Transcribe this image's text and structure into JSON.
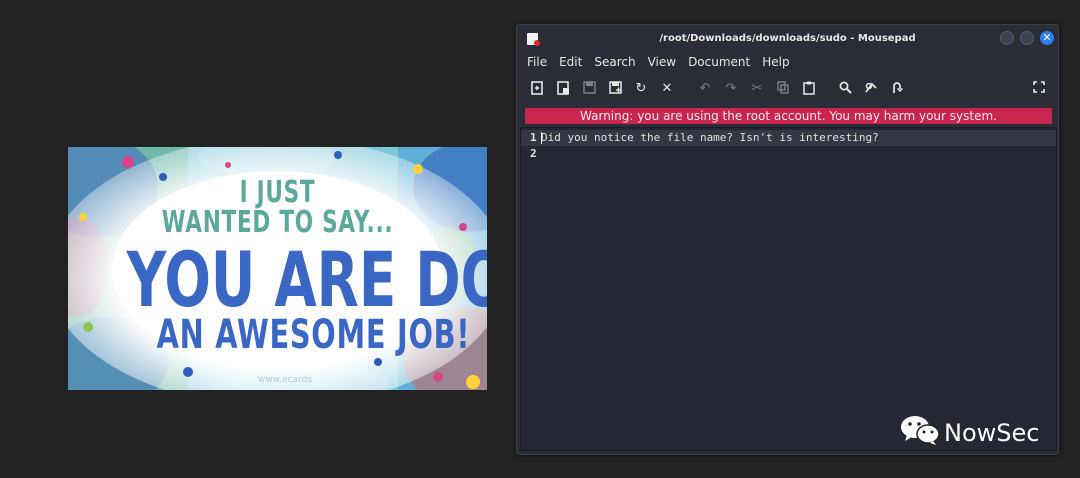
{
  "image_card": {
    "line1": "I JUST",
    "line2": "WANTED TO SAY...",
    "line3": "YOU ARE DOING",
    "line4": "AN AWESOME JOB!",
    "watermark": "www.ecards"
  },
  "window": {
    "title": "/root/Downloads/downloads/sudo - Mousepad",
    "menu": [
      "File",
      "Edit",
      "Search",
      "View",
      "Document",
      "Help"
    ],
    "warning": "Warning: you are using the root account. You may harm your system.",
    "lines": [
      {
        "number": "1",
        "text": "Did you notice the file name? Isn't is interesting?"
      },
      {
        "number": "2",
        "text": ""
      }
    ]
  },
  "overlay": {
    "brand": "NowSec"
  }
}
